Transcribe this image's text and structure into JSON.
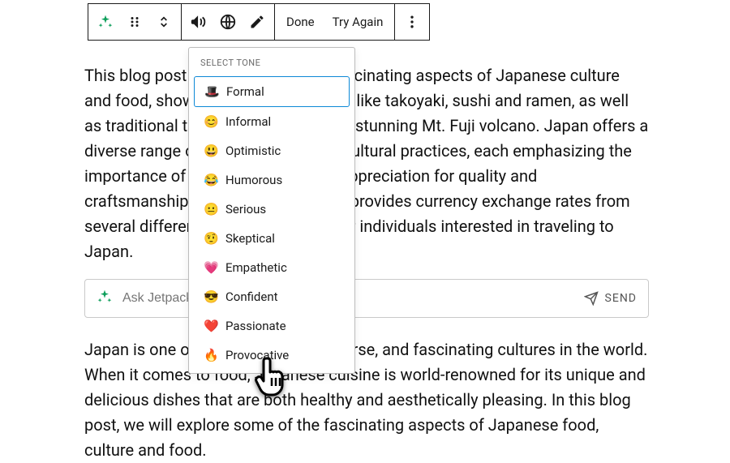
{
  "toolbar": {
    "done": "Done",
    "try_again": "Try Again"
  },
  "body": {
    "para1": "This blog post focuses on various fascinating aspects of Japanese culture and food, showcasing popular dishes like takoyaki, sushi and ramen, as well as traditional tea ceremonies and the stunning Mt. Fuji volcano. Japan offers a diverse range of unique cuisine and cultural practices, each emphasizing the importance of ritual, discipline, and appreciation for quality and craftsmanship. Additionally, the blog provides currency exchange rates from several different currencies to JPY for individuals interested in traveling to Japan.",
    "para2": "Japan is one of the most unique, diverse, and fascinating cultures in the world. When it comes to food, Japanese cuisine is world-renowned for its unique and delicious dishes that are both healthy and aesthetically pleasing. In this blog post, we will explore some of the fascinating aspects of Japanese food, culture and food."
  },
  "ask": {
    "placeholder": "Ask Jetpack AI",
    "send": "SEND"
  },
  "tone": {
    "header": "SELECT TONE",
    "items": [
      {
        "emoji": "🎩",
        "label": "Formal"
      },
      {
        "emoji": "😊",
        "label": "Informal"
      },
      {
        "emoji": "😃",
        "label": "Optimistic"
      },
      {
        "emoji": "😂",
        "label": "Humorous"
      },
      {
        "emoji": "😐",
        "label": "Serious"
      },
      {
        "emoji": "🤨",
        "label": "Skeptical"
      },
      {
        "emoji": "💗",
        "label": "Empathetic"
      },
      {
        "emoji": "😎",
        "label": "Confident"
      },
      {
        "emoji": "❤️",
        "label": "Passionate"
      },
      {
        "emoji": "🔥",
        "label": "Provocative"
      }
    ],
    "selected_index": 0
  }
}
